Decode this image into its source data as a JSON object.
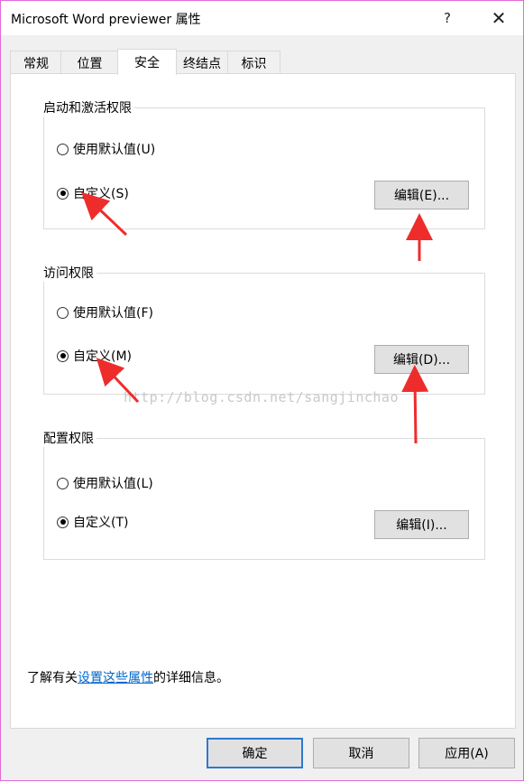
{
  "window": {
    "title": "Microsoft Word previewer 属性",
    "help": "?",
    "close": "✕"
  },
  "tabs": [
    "常规",
    "位置",
    "安全",
    "终结点",
    "标识"
  ],
  "active_tab": "安全",
  "groups": [
    {
      "title": "启动和激活权限",
      "default_label": "使用默认值(U)",
      "custom_label": "自定义(S)",
      "selected": "custom",
      "edit_label": "编辑(E)..."
    },
    {
      "title": "访问权限",
      "default_label": "使用默认值(F)",
      "custom_label": "自定义(M)",
      "selected": "custom",
      "edit_label": "编辑(D)..."
    },
    {
      "title": "配置权限",
      "default_label": "使用默认值(L)",
      "custom_label": "自定义(T)",
      "selected": "custom",
      "edit_label": "编辑(I)..."
    }
  ],
  "footer": {
    "prefix": "了解有关",
    "link": "设置这些属性",
    "suffix": "的详细信息。"
  },
  "buttons": {
    "ok": "确定",
    "cancel": "取消",
    "apply": "应用(A)"
  },
  "watermark": "http://blog.csdn.net/sangjinchao",
  "colors": {
    "annotation_arrow": "#ee2c2c",
    "link": "#0066cc",
    "default_button_border": "#2f78d0"
  }
}
